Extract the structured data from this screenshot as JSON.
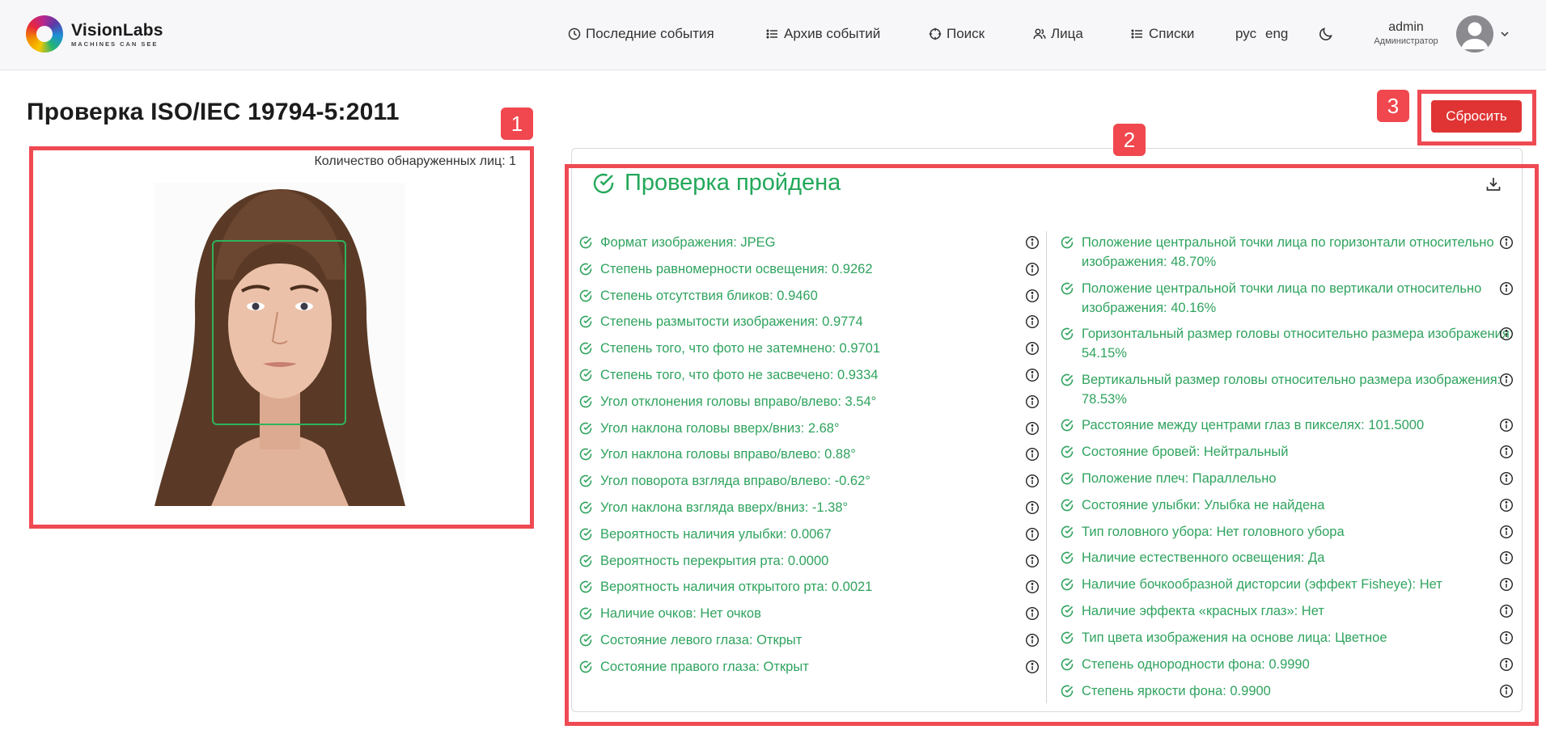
{
  "header": {
    "logo_title": "VisionLabs",
    "logo_subtitle": "MACHINES CAN SEE",
    "nav": [
      {
        "label": "Последние события",
        "icon": "clock-icon"
      },
      {
        "label": "Архив событий",
        "icon": "list-icon"
      },
      {
        "label": "Поиск",
        "icon": "crosshair-icon"
      },
      {
        "label": "Лица",
        "icon": "users-icon"
      },
      {
        "label": "Списки",
        "icon": "list-icon"
      }
    ],
    "lang_ru": "рус",
    "lang_en": "eng",
    "theme_icon": "moon-icon",
    "user_name": "admin",
    "user_role": "Администратор"
  },
  "page": {
    "title": "Проверка ISO/IEC 19794-5:2011",
    "faces_detected": "Количество обнаруженных лиц: 1",
    "reset_label": "Сбросить"
  },
  "badges": [
    "1",
    "2",
    "3"
  ],
  "result": {
    "title": "Проверка пройдена",
    "status_color": "#23a85a",
    "left_items": [
      "Формат изображения: JPEG",
      "Степень равномерности освещения: 0.9262",
      "Степень отсутствия бликов: 0.9460",
      "Степень размытости изображения: 0.9774",
      "Степень того, что фото не затемнено: 0.9701",
      "Степень того, что фото не засвечено: 0.9334",
      "Угол отклонения головы вправо/влево: 3.54°",
      "Угол наклона головы вверх/вниз: 2.68°",
      "Угол наклона головы вправо/влево: 0.88°",
      "Угол поворота взгляда вправо/влево: -0.62°",
      "Угол наклона взгляда вверх/вниз: -1.38°",
      "Вероятность наличия улыбки: 0.0067",
      "Вероятность перекрытия рта: 0.0000",
      "Вероятность наличия открытого рта: 0.0021",
      "Наличие очков: Нет очков",
      "Состояние левого глаза: Открыт",
      "Состояние правого глаза: Открыт"
    ],
    "right_items": [
      "Положение центральной точки лица по горизонтали относительно изображения: 48.70%",
      "Положение центральной точки лица по вертикали относительно изображения: 40.16%",
      "Горизонтальный размер головы относительно размера изображения: 54.15%",
      "Вертикальный размер головы относительно размера изображения: 78.53%",
      "Расстояние между центрами глаз в пикселях: 101.5000",
      "Состояние бровей: Нейтральный",
      "Положение плеч: Параллельно",
      "Состояние улыбки: Улыбка не найдена",
      "Тип головного убора: Нет головного убора",
      "Наличие естественного освещения: Да",
      "Наличие бочкообразной дисторсии (эффект Fisheye): Нет",
      "Наличие эффекта «красных глаз»: Нет",
      "Тип цвета изображения на основе лица: Цветное",
      "Степень однородности фона: 0.9990",
      "Степень яркости фона: 0.9900"
    ]
  }
}
